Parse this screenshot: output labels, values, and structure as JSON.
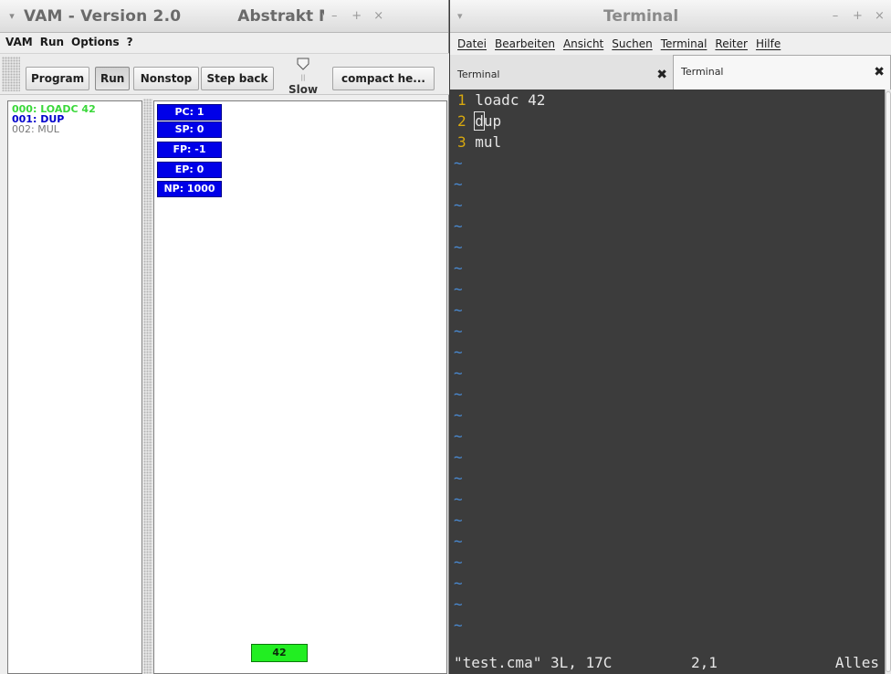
{
  "vam": {
    "title": "VAM - Version 2.0",
    "title_secondary": "Abstrakt Maschine",
    "menu": [
      "VAM",
      "Run",
      "Options",
      "?"
    ],
    "toolbar": {
      "program_label": "Program",
      "run_label": "Run",
      "nonstop_label": "Nonstop",
      "stepback_label": "Step back",
      "speed_label": "Slow",
      "compact_label": "compact he..."
    },
    "code": [
      "000:  LOADC 42",
      "001:  DUP",
      "002:  MUL"
    ],
    "registers": [
      "PC: 1",
      "SP: 0",
      "FP: -1",
      "EP: 0",
      "NP: 1000"
    ],
    "stack": [
      "42"
    ],
    "colors": {
      "register_bg": "#0000e8",
      "stack_bg": "#22ee22",
      "current_line": "#3ad83a",
      "next_line": "#0000cc"
    }
  },
  "terminal": {
    "title": "Terminal",
    "menu": [
      "Datei",
      "Bearbeiten",
      "Ansicht",
      "Suchen",
      "Terminal",
      "Reiter",
      "Hilfe"
    ],
    "tabs": [
      {
        "label": "Terminal",
        "active": false
      },
      {
        "label": "Terminal",
        "active": true
      }
    ],
    "lines": [
      {
        "num": "1",
        "text": "loadc 42"
      },
      {
        "num": "2",
        "text": "dup"
      },
      {
        "num": "3",
        "text": "mul"
      }
    ],
    "tilde": "~",
    "status_file": "\"test.cma\" 3L, 17C",
    "status_pos": "2,1",
    "status_view": "Alles"
  }
}
